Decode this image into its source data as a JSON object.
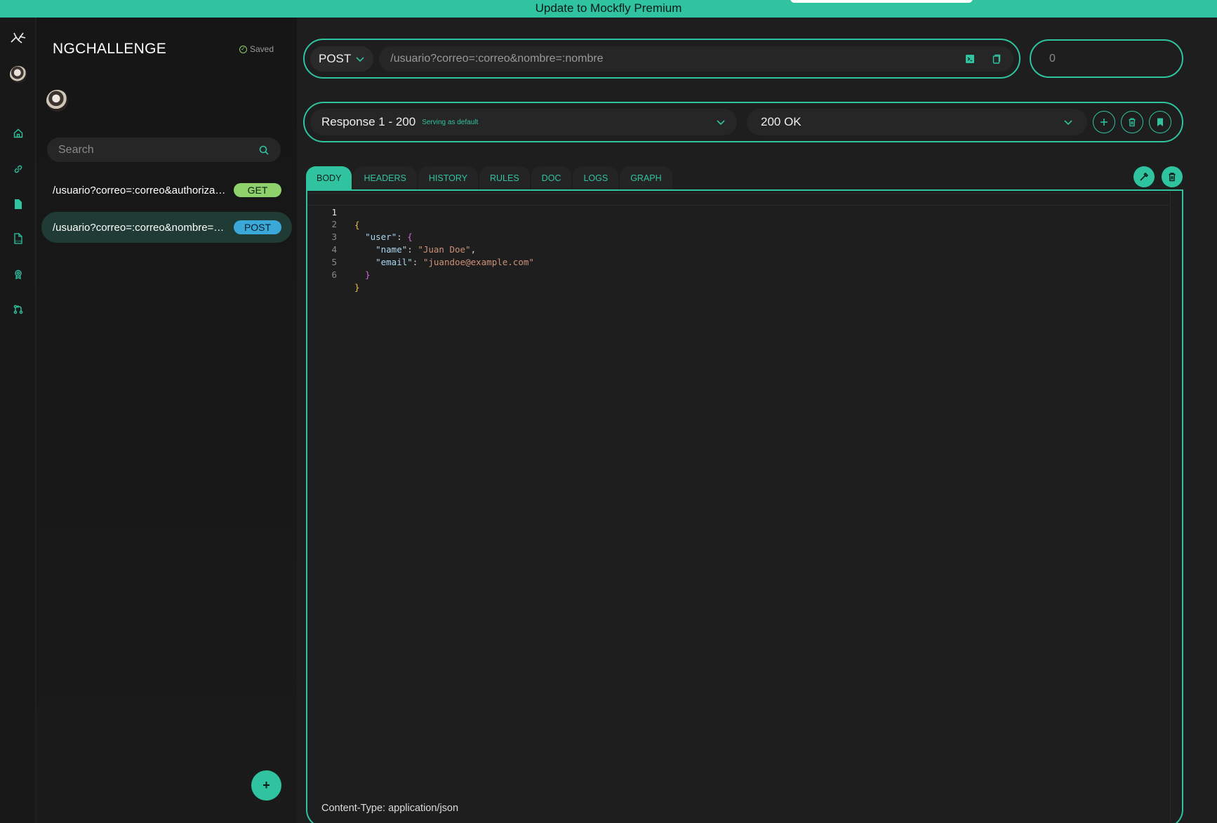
{
  "banner": {
    "text": "Update to Mockfly Premium"
  },
  "rail": {
    "icons": [
      "mockfly-logo-icon",
      "avatar",
      "home-icon",
      "link-icon",
      "file-icon",
      "json-file-icon",
      "award-icon",
      "git-branch-icon"
    ]
  },
  "sidebar": {
    "project_title": "NGCHALLENGE",
    "saved_label": "Saved",
    "search_placeholder": "Search",
    "endpoints": [
      {
        "path": "/usuario?correo=:correo&authorizati...",
        "method": "GET",
        "active": false
      },
      {
        "path": "/usuario?correo=:correo&nombre=:n...",
        "method": "POST",
        "active": true
      }
    ],
    "add_button": "+"
  },
  "request": {
    "method": "POST",
    "url": "/usuario?correo=:correo&nombre=:nombre",
    "delay": "0"
  },
  "response": {
    "name": "Response 1 - 200",
    "default_label": "Serving as default",
    "status": "200 OK"
  },
  "tabs": [
    {
      "label": "BODY",
      "active": true
    },
    {
      "label": "HEADERS",
      "active": false
    },
    {
      "label": "HISTORY",
      "active": false
    },
    {
      "label": "RULES",
      "active": false
    },
    {
      "label": "DOC",
      "active": false
    },
    {
      "label": "LOGS",
      "active": false
    },
    {
      "label": "GRAPH",
      "active": false
    }
  ],
  "editor": {
    "line_numbers": [
      "1",
      "2",
      "3",
      "4",
      "5",
      "6"
    ],
    "lines": {
      "l1_brace": "{",
      "l2_key": "\"user\"",
      "l2_colon": ": ",
      "l2_brace": "{",
      "l3_key": "\"name\"",
      "l3_colon": ": ",
      "l3_val": "\"Juan Doe\"",
      "l3_comma": ",",
      "l4_key": "\"email\"",
      "l4_colon": ": ",
      "l4_val": "\"juandoe@example.com\"",
      "l5_brace": "}",
      "l6_brace": "}"
    },
    "content_type": "Content-Type: application/json"
  },
  "colors": {
    "accent": "#2fc3a0",
    "get_badge": "#8fd16a",
    "post_badge": "#3aa9d9",
    "background": "#1e1e1e"
  }
}
